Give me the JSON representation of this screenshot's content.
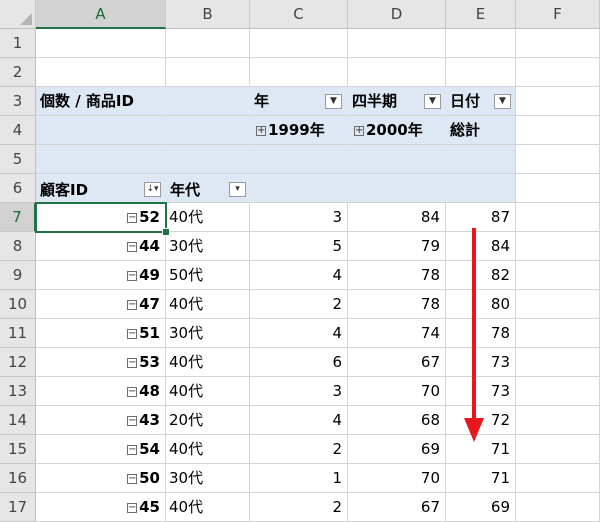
{
  "columns": [
    "A",
    "B",
    "C",
    "D",
    "E",
    "F"
  ],
  "selected_col": "A",
  "selected_row": 7,
  "rows_visible": [
    1,
    2,
    3,
    4,
    5,
    6,
    7,
    8,
    9,
    10,
    11,
    12,
    13,
    14,
    15,
    16,
    17
  ],
  "pivot": {
    "title": "個数 / 商品ID",
    "year_label": "年",
    "quarter_label": "四半期",
    "date_label": "日付",
    "year_1999": "1999年",
    "year_2000": "2000年",
    "total_label": "総計",
    "customer_label": "顧客ID",
    "age_label": "年代"
  },
  "data_rows": [
    {
      "id": "52",
      "age": "40代",
      "c": "3",
      "d": "84",
      "e": "87"
    },
    {
      "id": "44",
      "age": "30代",
      "c": "5",
      "d": "79",
      "e": "84"
    },
    {
      "id": "49",
      "age": "50代",
      "c": "4",
      "d": "78",
      "e": "82"
    },
    {
      "id": "47",
      "age": "40代",
      "c": "2",
      "d": "78",
      "e": "80"
    },
    {
      "id": "51",
      "age": "30代",
      "c": "4",
      "d": "74",
      "e": "78"
    },
    {
      "id": "53",
      "age": "40代",
      "c": "6",
      "d": "67",
      "e": "73"
    },
    {
      "id": "48",
      "age": "40代",
      "c": "3",
      "d": "70",
      "e": "73"
    },
    {
      "id": "43",
      "age": "20代",
      "c": "4",
      "d": "68",
      "e": "72"
    },
    {
      "id": "54",
      "age": "40代",
      "c": "2",
      "d": "69",
      "e": "71"
    },
    {
      "id": "50",
      "age": "30代",
      "c": "1",
      "d": "70",
      "e": "71"
    },
    {
      "id": "45",
      "age": "40代",
      "c": "2",
      "d": "67",
      "e": "69"
    }
  ],
  "colors": {
    "pivot_header": "#dde8f4",
    "selection": "#217346",
    "arrow": "#e8171b"
  },
  "icons": {
    "dropdown": "filter-dropdown-icon",
    "sort_filter": "sort-filter-icon",
    "expand": "expand-plus-icon",
    "collapse": "collapse-minus-icon"
  }
}
